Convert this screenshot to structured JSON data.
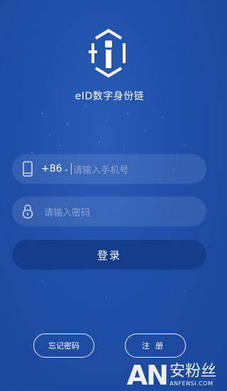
{
  "app": {
    "title": "eID数字身份链"
  },
  "login_form": {
    "phone": {
      "country_code": "+86",
      "placeholder": "请输入手机号"
    },
    "password": {
      "placeholder": "请输入密码"
    },
    "login_label": "登录"
  },
  "footer": {
    "forgot_label": "忘记密码",
    "register_label": "注册"
  },
  "watermark": {
    "mark": "AN",
    "cn": "安粉丝",
    "en": "ANFENSI.COM"
  },
  "icons": {
    "logo": "eid-hexagon-logo",
    "phone": "phone-icon",
    "lock": "lock-icon",
    "dropdown": "chevron-down-icon"
  },
  "colors": {
    "background": "#1f4fa8",
    "button": "#163c8c",
    "placeholder": "#8fa6d6"
  }
}
